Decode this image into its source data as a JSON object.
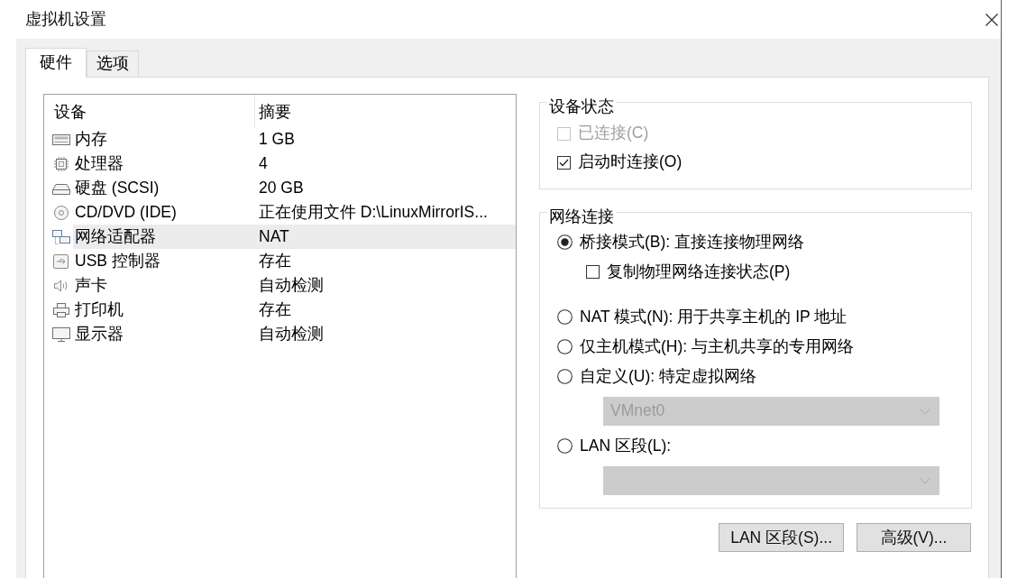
{
  "window": {
    "title": "虚拟机设置"
  },
  "tabs": [
    {
      "label": "硬件",
      "selected": true
    },
    {
      "label": "选项",
      "selected": false
    }
  ],
  "device_table": {
    "columns": [
      "设备",
      "摘要"
    ],
    "rows": [
      {
        "kind": "memory",
        "device": "内存",
        "summary": "1 GB",
        "selected": false
      },
      {
        "kind": "processor",
        "device": "处理器",
        "summary": "4",
        "selected": false
      },
      {
        "kind": "disk",
        "device": "硬盘 (SCSI)",
        "summary": "20 GB",
        "selected": false
      },
      {
        "kind": "cd",
        "device": "CD/DVD (IDE)",
        "summary": "正在使用文件 D:\\LinuxMirrorIS...",
        "selected": false
      },
      {
        "kind": "network",
        "device": "网络适配器",
        "summary": "NAT",
        "selected": true
      },
      {
        "kind": "usb",
        "device": "USB 控制器",
        "summary": "存在",
        "selected": false
      },
      {
        "kind": "sound",
        "device": "声卡",
        "summary": "自动检测",
        "selected": false
      },
      {
        "kind": "printer",
        "device": "打印机",
        "summary": "存在",
        "selected": false
      },
      {
        "kind": "display",
        "device": "显示器",
        "summary": "自动检测",
        "selected": false
      }
    ]
  },
  "device_status": {
    "title": "设备状态",
    "options": [
      {
        "label": "已连接(C)",
        "checked": false,
        "disabled": true
      },
      {
        "label": "启动时连接(O)",
        "checked": true,
        "disabled": false
      }
    ]
  },
  "network_connection": {
    "title": "网络连接",
    "options": [
      {
        "kind": "radio",
        "label": "桥接模式(B): 直接连接物理网络",
        "selected": true,
        "disabled": false
      },
      {
        "kind": "checkbox",
        "label": "复制物理网络连接状态(P)",
        "checked": false,
        "disabled": false
      },
      {
        "kind": "radio",
        "label": "NAT 模式(N): 用于共享主机的 IP 地址",
        "selected": false,
        "disabled": false
      },
      {
        "kind": "radio",
        "label": "仅主机模式(H): 与主机共享的专用网络",
        "selected": false,
        "disabled": false
      },
      {
        "kind": "radio",
        "label": "自定义(U): 特定虚拟网络",
        "selected": false,
        "disabled": false
      },
      {
        "kind": "dropdown",
        "value": "VMnet0",
        "disabled": true
      },
      {
        "kind": "radio",
        "label": "LAN 区段(L):",
        "selected": false,
        "disabled": false
      },
      {
        "kind": "dropdown",
        "disabled": true
      }
    ]
  },
  "buttons": [
    "LAN 区段(S)...",
    "高级(V)..."
  ]
}
